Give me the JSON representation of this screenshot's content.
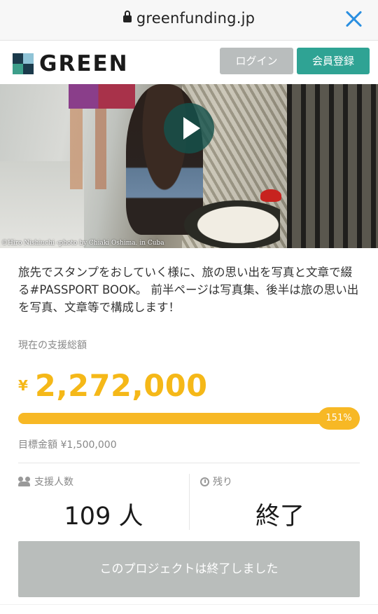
{
  "browser": {
    "domain": "greenfunding.jp"
  },
  "header": {
    "logo_text": "GREEN",
    "login_label": "ログイン",
    "register_label": "会員登録"
  },
  "hero": {
    "credit": "©Hiro Nishiuchi ‹photo by Chiaki Oshima. in Cuba"
  },
  "project": {
    "description": "旅先でスタンプをおしていく様に、旅の思い出を写真と文章で綴る#PASSPORT BOOK。 前半ページは写真集、後半は旅の思い出を写真、文章等で構成します！",
    "raised_label": "現在の支援総額",
    "currency_symbol": "¥",
    "raised_amount": "2,272,000",
    "progress_percent": 151,
    "progress_label": "151%",
    "goal_text": "目標金額 ¥1,500,000",
    "supporters_label": "支援人数",
    "supporters_value": "109 人",
    "remaining_label": "残り",
    "remaining_value": "終了",
    "ended_button_label": "このプロジェクトは終了しました"
  },
  "colors": {
    "accent_yellow": "#f5b818",
    "brand_green": "#2fa394",
    "close_blue": "#2b8fe0",
    "disabled_gray": "#b9bdbb"
  }
}
